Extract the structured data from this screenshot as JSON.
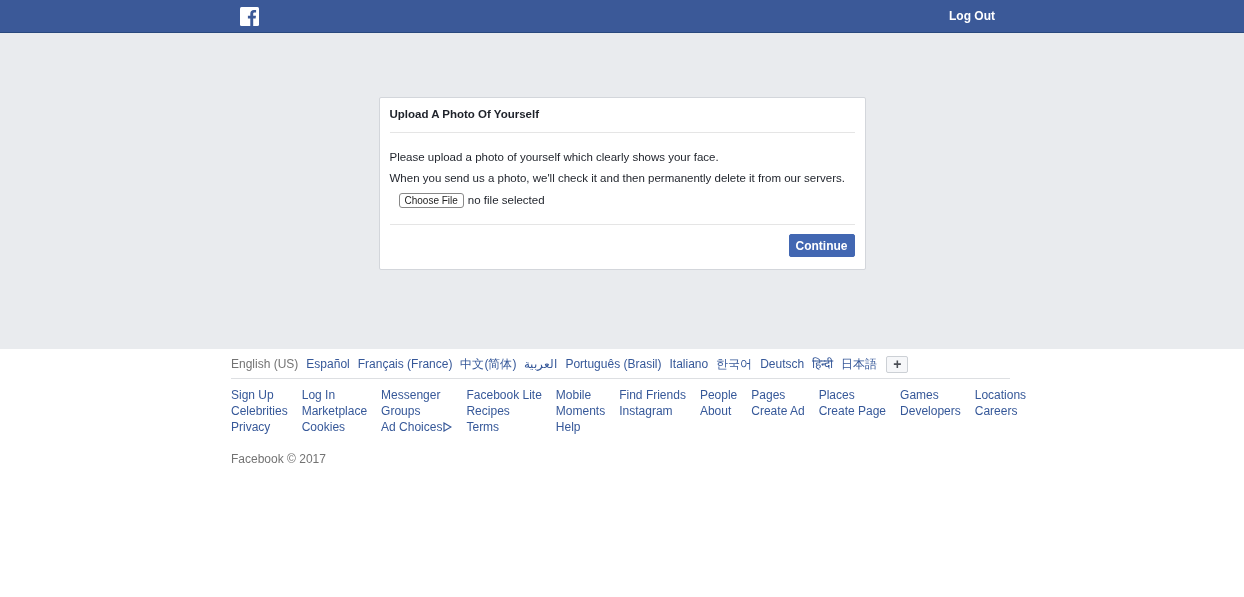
{
  "header": {
    "logout": "Log Out"
  },
  "dialog": {
    "title": "Upload A Photo Of Yourself",
    "paragraphs": [
      "Please upload a photo of yourself which clearly shows your face.",
      "When you send us a photo, we'll check it and then permanently delete it from our servers."
    ],
    "file_button": "Choose File",
    "file_status": "no file selected",
    "continue": "Continue"
  },
  "languages": [
    {
      "label": "English (US)",
      "selected": true
    },
    {
      "label": "Español",
      "selected": false
    },
    {
      "label": "Français (France)",
      "selected": false
    },
    {
      "label": "中文(简体)",
      "selected": false
    },
    {
      "label": "العربية",
      "selected": false
    },
    {
      "label": "Português (Brasil)",
      "selected": false
    },
    {
      "label": "Italiano",
      "selected": false
    },
    {
      "label": "한국어",
      "selected": false
    },
    {
      "label": "Deutsch",
      "selected": false
    },
    {
      "label": "हिन्दी",
      "selected": false
    },
    {
      "label": "日本語",
      "selected": false
    }
  ],
  "more_languages": "+",
  "footer_columns": [
    [
      {
        "label": "Sign Up",
        "kind": "link"
      },
      {
        "label": "Celebrities",
        "kind": "link"
      },
      {
        "label": "Privacy",
        "kind": "link"
      }
    ],
    [
      {
        "label": "Log In",
        "kind": "link"
      },
      {
        "label": "Marketplace",
        "kind": "link"
      },
      {
        "label": "Cookies",
        "kind": "link"
      }
    ],
    [
      {
        "label": "Messenger",
        "kind": "link"
      },
      {
        "label": "Groups",
        "kind": "link"
      },
      {
        "label": "Ad Choices",
        "kind": "adchoices"
      }
    ],
    [
      {
        "label": "Facebook Lite",
        "kind": "link"
      },
      {
        "label": "Recipes",
        "kind": "link"
      },
      {
        "label": "Terms",
        "kind": "link"
      }
    ],
    [
      {
        "label": "Mobile",
        "kind": "link"
      },
      {
        "label": "Moments",
        "kind": "link"
      },
      {
        "label": "Help",
        "kind": "link"
      }
    ],
    [
      {
        "label": "Find Friends",
        "kind": "link"
      },
      {
        "label": "Instagram",
        "kind": "link"
      }
    ],
    [
      {
        "label": "People",
        "kind": "link"
      },
      {
        "label": "About",
        "kind": "link"
      }
    ],
    [
      {
        "label": "Pages",
        "kind": "link"
      },
      {
        "label": "Create Ad",
        "kind": "link"
      }
    ],
    [
      {
        "label": "Places",
        "kind": "link"
      },
      {
        "label": "Create Page",
        "kind": "link"
      }
    ],
    [
      {
        "label": "Games",
        "kind": "link"
      },
      {
        "label": "Developers",
        "kind": "link"
      }
    ],
    [
      {
        "label": "Locations",
        "kind": "link"
      },
      {
        "label": "Careers",
        "kind": "link"
      }
    ]
  ],
  "copyright": "Facebook © 2017"
}
